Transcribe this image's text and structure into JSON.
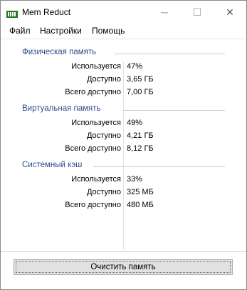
{
  "window": {
    "title": "Mem Reduct",
    "icon": "mem-reduct-app-icon",
    "controls": {
      "minimize": "─",
      "maximize": "☐",
      "close": "✕"
    }
  },
  "menu": {
    "items": [
      "Файл",
      "Настройки",
      "Помощь"
    ]
  },
  "sections": [
    {
      "title": "Физическая память",
      "rows": [
        {
          "label": "Используется",
          "value": "47%"
        },
        {
          "label": "Доступно",
          "value": "3,65 ГБ"
        },
        {
          "label": "Всего доступно",
          "value": "7,00 ГБ"
        }
      ]
    },
    {
      "title": "Виртуальная память",
      "rows": [
        {
          "label": "Используется",
          "value": "49%"
        },
        {
          "label": "Доступно",
          "value": "4,21 ГБ"
        },
        {
          "label": "Всего доступно",
          "value": "8,12 ГБ"
        }
      ]
    },
    {
      "title": "Системный кэш",
      "rows": [
        {
          "label": "Используется",
          "value": "33%"
        },
        {
          "label": "Доступно",
          "value": "325 МБ"
        },
        {
          "label": "Всего доступно",
          "value": "480 МБ"
        }
      ]
    }
  ],
  "actions": {
    "clean_label": "Очистить память"
  },
  "colors": {
    "section_title": "#2d4d8c",
    "button_bg": "#e1e1e1"
  }
}
